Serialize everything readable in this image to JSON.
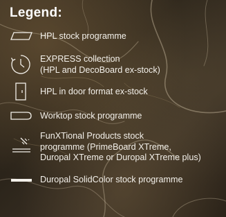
{
  "legend": {
    "title": "Legend:",
    "items": [
      {
        "id": "hpl",
        "icon": "parallelogram-sheet-icon",
        "lines": [
          "HPL stock programme"
        ]
      },
      {
        "id": "express",
        "icon": "clock-icon",
        "lines": [
          "EXPRESS collection",
          "(HPL and DecoBoard ex-stock)"
        ]
      },
      {
        "id": "door",
        "icon": "door-icon",
        "lines": [
          "HPL in door format ex-stock"
        ]
      },
      {
        "id": "worktop",
        "icon": "worktop-icon",
        "lines": [
          "Worktop stock programme"
        ]
      },
      {
        "id": "funx",
        "icon": "sparkle-board-icon",
        "lines": [
          "FunXTional Products stock",
          "programme (PrimeBoard XTreme,",
          "Duropal XTreme or Duropal XTreme plus)"
        ]
      },
      {
        "id": "solidcolor",
        "icon": "solid-bar-icon",
        "lines": [
          "Duropal SolidColor stock programme"
        ]
      }
    ]
  },
  "colors": {
    "text": "#f3f0ea",
    "icon": "#f3f0ea",
    "background": "#2f271c"
  }
}
